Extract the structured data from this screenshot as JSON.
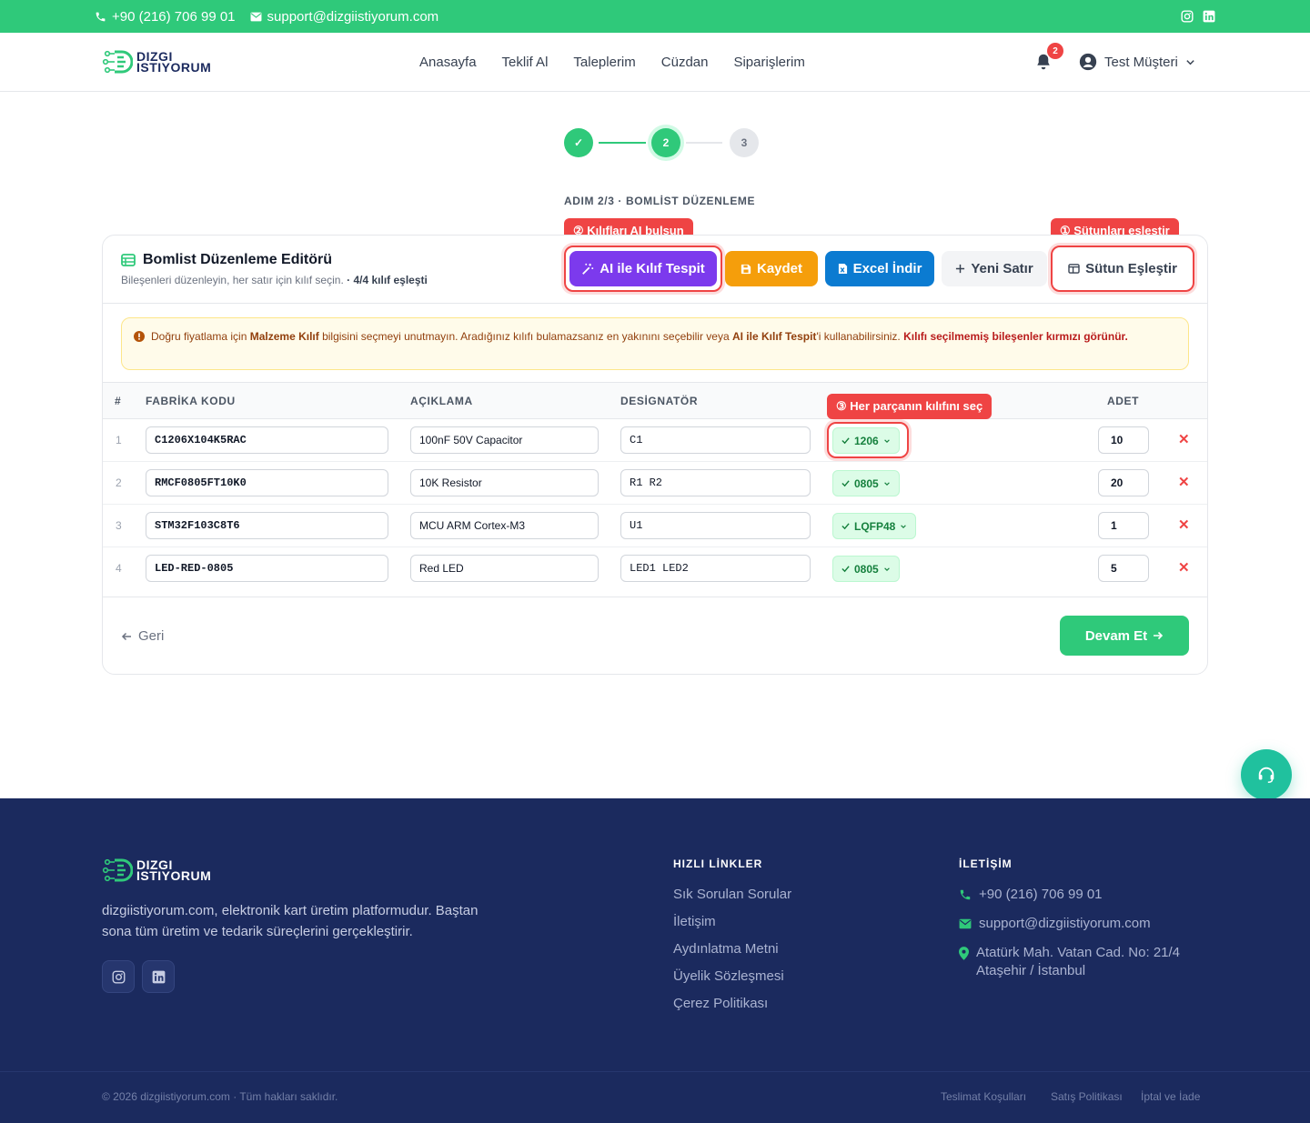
{
  "topbar": {
    "phone": "+90 (216) 706 99 01",
    "email": "support@dizgiistiyorum.com",
    "icons": [
      "instagram-icon",
      "linkedin-icon"
    ]
  },
  "brand": {
    "line1": "DIZGI",
    "line2": "ISTIYORUM"
  },
  "nav": {
    "links": [
      "Anasayfa",
      "Teklif Al",
      "Taleplerim",
      "Cüzdan",
      "Siparişlerim"
    ],
    "notification_count": "2",
    "user_name": "Test Müşteri"
  },
  "stepper": {
    "steps": [
      "✓",
      "2",
      "3"
    ],
    "caption": "ADIM 2/3 · BOMLİST DÜZENLEME"
  },
  "editor": {
    "title": "Bomlist Düzenleme Editörü",
    "subtitle": "Bileşenleri düzenleyin, her satır için kılıf seçin.",
    "match_status": "· 4/4 kılıf eşleşti",
    "buttons": {
      "ai": "AI ile Kılıf Tespit",
      "save": "Kaydet",
      "excel": "Excel İndir",
      "new_row": "Yeni Satır",
      "map_columns": "Sütun Eşleştir"
    },
    "tooltips": {
      "t1": "① Sütunları eşleştir",
      "t2": "② Kılıfları AI bulsun",
      "t3": "③ Her parçanın kılıfını seç"
    },
    "alert": {
      "p1": "Doğru fiyatlama için ",
      "b1": "Malzeme Kılıf",
      "p2": " bilgisini seçmeyi unutmayın. Aradığınız kılıfı bulamazsanız en yakınını seçebilir veya ",
      "b2": "AI ile Kılıf Tespit",
      "p3": "'i kullanabilirsiniz. ",
      "warn": "Kılıfı seçilmemiş bileşenler kırmızı görünür."
    },
    "columns": {
      "num": "#",
      "code": "FABRİKA KODU",
      "desc": "AÇIKLAMA",
      "designator": "DESİGNATÖR",
      "qty": "ADET"
    },
    "rows": [
      {
        "num": "1",
        "code": "C1206X104K5RAC",
        "desc": "100nF 50V Capacitor",
        "designator": "C1",
        "package": "1206",
        "qty": "10"
      },
      {
        "num": "2",
        "code": "RMCF0805FT10K0",
        "desc": "10K Resistor",
        "designator": "R1 R2",
        "package": "0805",
        "qty": "20"
      },
      {
        "num": "3",
        "code": "STM32F103C8T6",
        "desc": "MCU ARM Cortex-M3",
        "designator": "U1",
        "package": "LQFP48",
        "qty": "1"
      },
      {
        "num": "4",
        "code": "LED-RED-0805",
        "desc": "Red LED",
        "designator": "LED1 LED2",
        "package": "0805",
        "qty": "5"
      }
    ],
    "back_label": "Geri",
    "next_label": "Devam Et"
  },
  "footer": {
    "description": "dizgiistiyorum.com, elektronik kart üretim platformudur. Baştan sona tüm üretim ve tedarik süreçlerini gerçekleştirir.",
    "quick_links_title": "HIZLI LİNKLER",
    "quick_links": [
      "Sık Sorulan Sorular",
      "İletişim",
      "Aydınlatma Metni",
      "Üyelik Sözleşmesi",
      "Çerez Politikası"
    ],
    "contact_title": "İLETİŞİM",
    "phone": "+90 (216) 706 99 01",
    "email": "support@dizgiistiyorum.com",
    "address_line1": "Atatürk Mah. Vatan Cad. No: 21/4",
    "address_line2": "Ataşehir / İstanbul",
    "copyright": "© 2026 dizgiistiyorum.com · Tüm hakları saklıdır.",
    "bottom_links": [
      "Teslimat Koşulları",
      "Satış Politikası",
      "İptal ve İade"
    ]
  },
  "colors": {
    "primary": "#2fc97a",
    "footer_bg": "#1b2a5e",
    "ai_button": "#7c3aed",
    "save_button": "#f59e0b",
    "excel_button": "#0b7bd1",
    "highlight": "#ef4444",
    "support_button": "#20c19e"
  }
}
